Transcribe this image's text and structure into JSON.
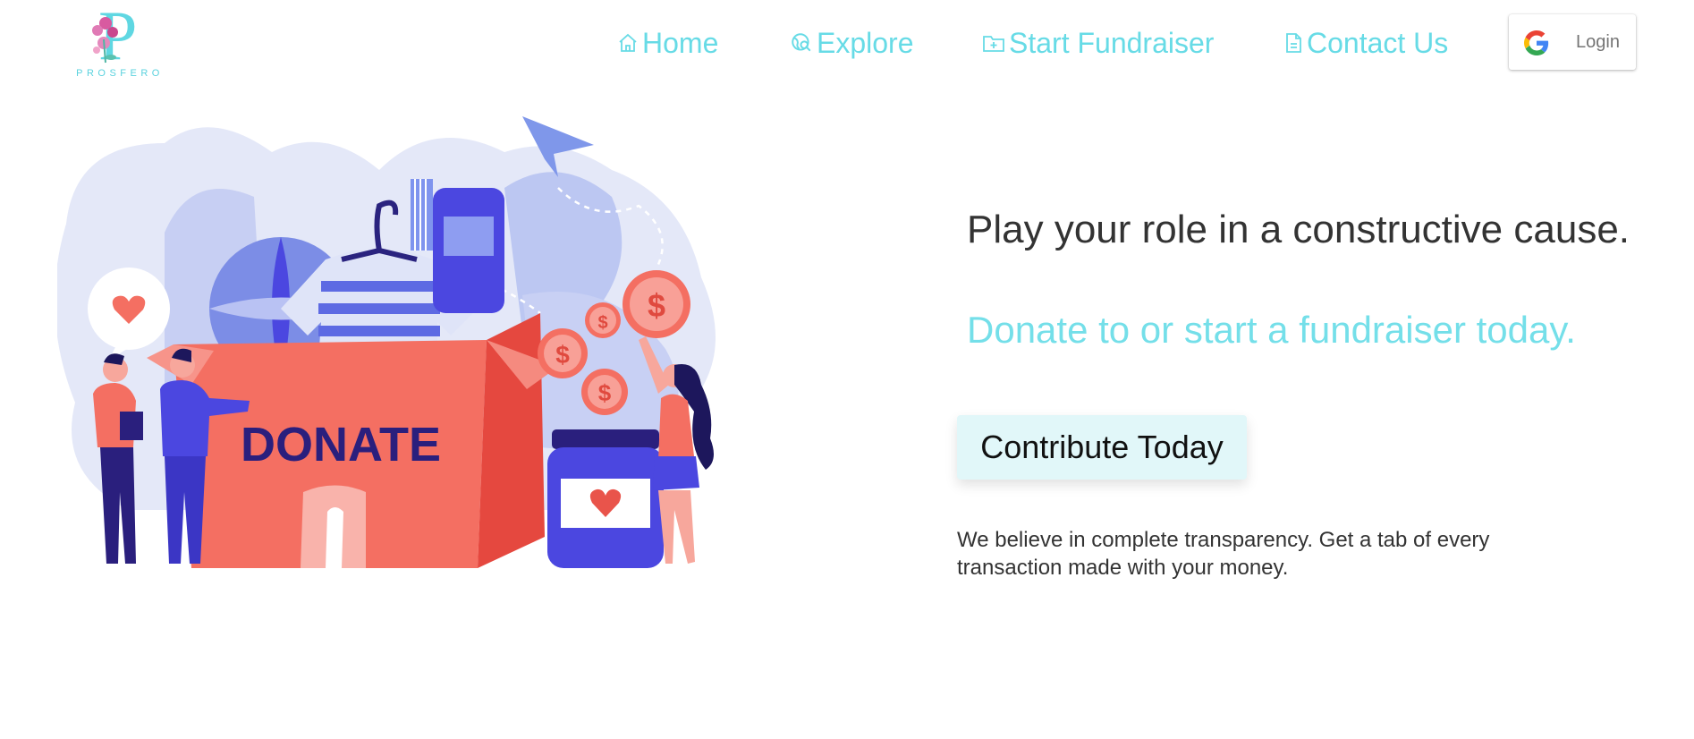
{
  "brand": {
    "logo_letter": "P",
    "logo_text": "PROSFERO"
  },
  "nav": {
    "home": {
      "label": "Home",
      "icon": "home-icon"
    },
    "explore": {
      "label": "Explore",
      "icon": "explore-icon"
    },
    "start": {
      "label": "Start Fundraiser",
      "icon": "folder-plus-icon"
    },
    "contact": {
      "label": "Contact Us",
      "icon": "document-icon"
    },
    "login": {
      "label": "Login",
      "icon": "google-icon"
    }
  },
  "hero": {
    "headline": "Play your role in a constructive cause.",
    "subline": "Donate to or start a fundraiser today.",
    "cta_label": "Contribute Today",
    "note": "We believe in complete transparency. Get a tab of every transaction made with your money.",
    "illustration_text": "DONATE"
  },
  "colors": {
    "accent": "#67dbe6",
    "cta_bg": "#e1f7f9",
    "text_dark": "#333333",
    "box_coral": "#f47466",
    "indigo": "#4b47e0"
  }
}
